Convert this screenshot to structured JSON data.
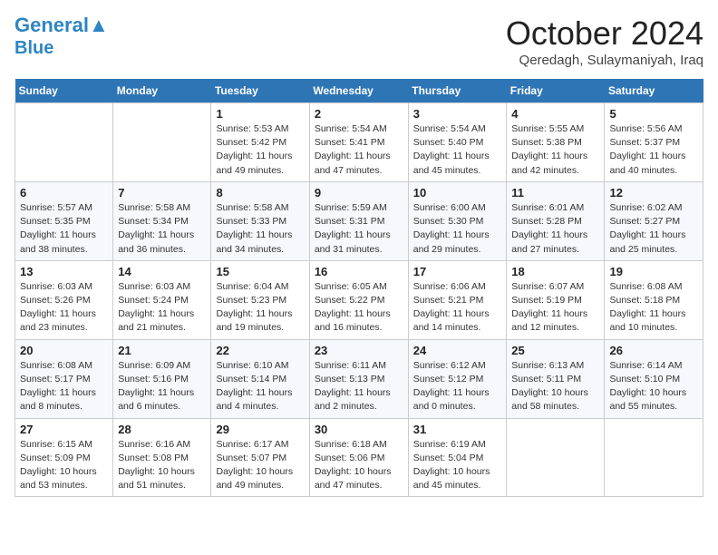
{
  "header": {
    "logo_line1": "General",
    "logo_line2": "Blue",
    "month": "October 2024",
    "location": "Qeredagh, Sulaymaniyah, Iraq"
  },
  "weekdays": [
    "Sunday",
    "Monday",
    "Tuesday",
    "Wednesday",
    "Thursday",
    "Friday",
    "Saturday"
  ],
  "weeks": [
    [
      {
        "day": "",
        "info": ""
      },
      {
        "day": "",
        "info": ""
      },
      {
        "day": "1",
        "info": "Sunrise: 5:53 AM\nSunset: 5:42 PM\nDaylight: 11 hours and 49 minutes."
      },
      {
        "day": "2",
        "info": "Sunrise: 5:54 AM\nSunset: 5:41 PM\nDaylight: 11 hours and 47 minutes."
      },
      {
        "day": "3",
        "info": "Sunrise: 5:54 AM\nSunset: 5:40 PM\nDaylight: 11 hours and 45 minutes."
      },
      {
        "day": "4",
        "info": "Sunrise: 5:55 AM\nSunset: 5:38 PM\nDaylight: 11 hours and 42 minutes."
      },
      {
        "day": "5",
        "info": "Sunrise: 5:56 AM\nSunset: 5:37 PM\nDaylight: 11 hours and 40 minutes."
      }
    ],
    [
      {
        "day": "6",
        "info": "Sunrise: 5:57 AM\nSunset: 5:35 PM\nDaylight: 11 hours and 38 minutes."
      },
      {
        "day": "7",
        "info": "Sunrise: 5:58 AM\nSunset: 5:34 PM\nDaylight: 11 hours and 36 minutes."
      },
      {
        "day": "8",
        "info": "Sunrise: 5:58 AM\nSunset: 5:33 PM\nDaylight: 11 hours and 34 minutes."
      },
      {
        "day": "9",
        "info": "Sunrise: 5:59 AM\nSunset: 5:31 PM\nDaylight: 11 hours and 31 minutes."
      },
      {
        "day": "10",
        "info": "Sunrise: 6:00 AM\nSunset: 5:30 PM\nDaylight: 11 hours and 29 minutes."
      },
      {
        "day": "11",
        "info": "Sunrise: 6:01 AM\nSunset: 5:28 PM\nDaylight: 11 hours and 27 minutes."
      },
      {
        "day": "12",
        "info": "Sunrise: 6:02 AM\nSunset: 5:27 PM\nDaylight: 11 hours and 25 minutes."
      }
    ],
    [
      {
        "day": "13",
        "info": "Sunrise: 6:03 AM\nSunset: 5:26 PM\nDaylight: 11 hours and 23 minutes."
      },
      {
        "day": "14",
        "info": "Sunrise: 6:03 AM\nSunset: 5:24 PM\nDaylight: 11 hours and 21 minutes."
      },
      {
        "day": "15",
        "info": "Sunrise: 6:04 AM\nSunset: 5:23 PM\nDaylight: 11 hours and 19 minutes."
      },
      {
        "day": "16",
        "info": "Sunrise: 6:05 AM\nSunset: 5:22 PM\nDaylight: 11 hours and 16 minutes."
      },
      {
        "day": "17",
        "info": "Sunrise: 6:06 AM\nSunset: 5:21 PM\nDaylight: 11 hours and 14 minutes."
      },
      {
        "day": "18",
        "info": "Sunrise: 6:07 AM\nSunset: 5:19 PM\nDaylight: 11 hours and 12 minutes."
      },
      {
        "day": "19",
        "info": "Sunrise: 6:08 AM\nSunset: 5:18 PM\nDaylight: 11 hours and 10 minutes."
      }
    ],
    [
      {
        "day": "20",
        "info": "Sunrise: 6:08 AM\nSunset: 5:17 PM\nDaylight: 11 hours and 8 minutes."
      },
      {
        "day": "21",
        "info": "Sunrise: 6:09 AM\nSunset: 5:16 PM\nDaylight: 11 hours and 6 minutes."
      },
      {
        "day": "22",
        "info": "Sunrise: 6:10 AM\nSunset: 5:14 PM\nDaylight: 11 hours and 4 minutes."
      },
      {
        "day": "23",
        "info": "Sunrise: 6:11 AM\nSunset: 5:13 PM\nDaylight: 11 hours and 2 minutes."
      },
      {
        "day": "24",
        "info": "Sunrise: 6:12 AM\nSunset: 5:12 PM\nDaylight: 11 hours and 0 minutes."
      },
      {
        "day": "25",
        "info": "Sunrise: 6:13 AM\nSunset: 5:11 PM\nDaylight: 10 hours and 58 minutes."
      },
      {
        "day": "26",
        "info": "Sunrise: 6:14 AM\nSunset: 5:10 PM\nDaylight: 10 hours and 55 minutes."
      }
    ],
    [
      {
        "day": "27",
        "info": "Sunrise: 6:15 AM\nSunset: 5:09 PM\nDaylight: 10 hours and 53 minutes."
      },
      {
        "day": "28",
        "info": "Sunrise: 6:16 AM\nSunset: 5:08 PM\nDaylight: 10 hours and 51 minutes."
      },
      {
        "day": "29",
        "info": "Sunrise: 6:17 AM\nSunset: 5:07 PM\nDaylight: 10 hours and 49 minutes."
      },
      {
        "day": "30",
        "info": "Sunrise: 6:18 AM\nSunset: 5:06 PM\nDaylight: 10 hours and 47 minutes."
      },
      {
        "day": "31",
        "info": "Sunrise: 6:19 AM\nSunset: 5:04 PM\nDaylight: 10 hours and 45 minutes."
      },
      {
        "day": "",
        "info": ""
      },
      {
        "day": "",
        "info": ""
      }
    ]
  ]
}
